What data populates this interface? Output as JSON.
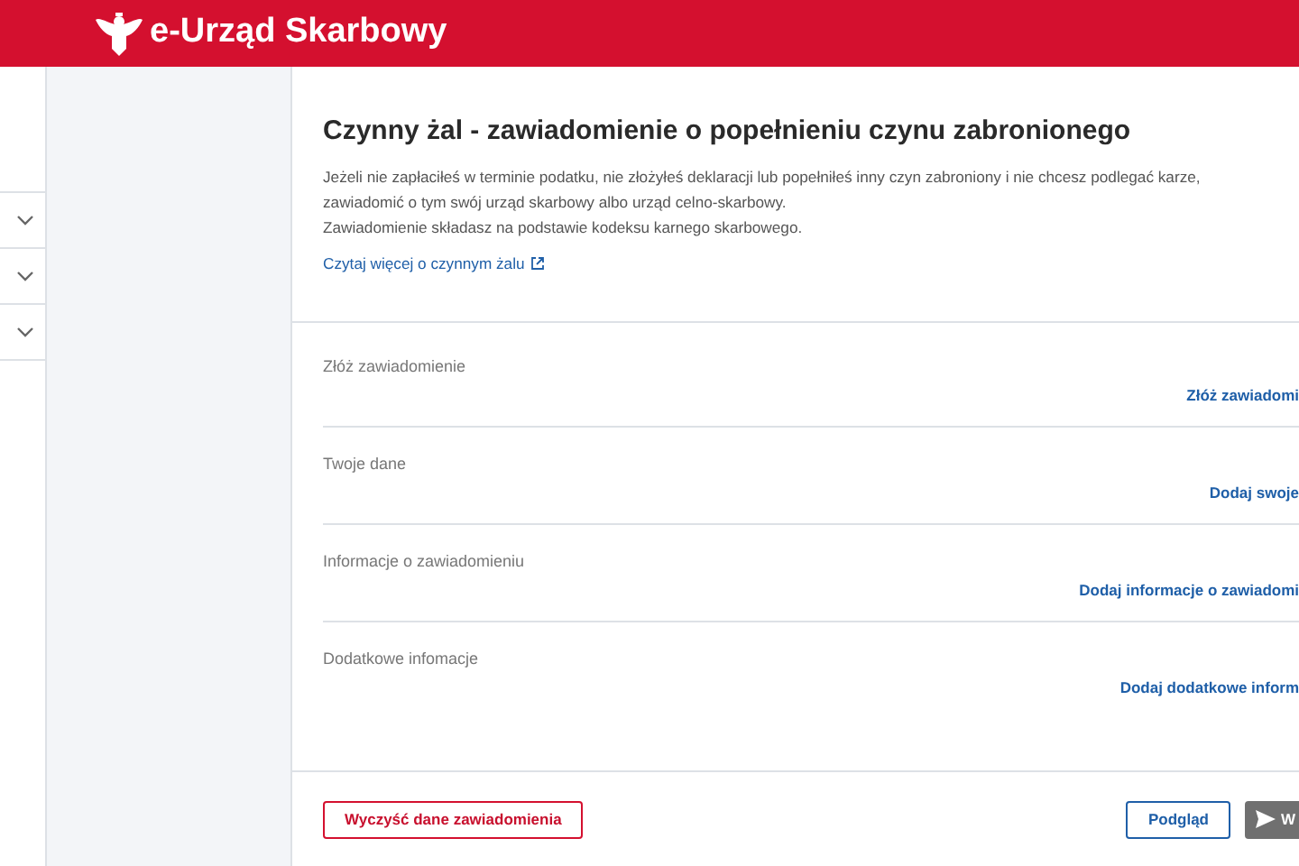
{
  "header": {
    "title": "e-Urząd Skarbowy"
  },
  "sidebar": {
    "items": [
      {
        "expanded": false
      },
      {
        "expanded": false
      },
      {
        "expanded": false
      }
    ]
  },
  "page": {
    "title": "Czynny żal - zawiadomienie o popełnieniu czynu zabronionego",
    "description": [
      "Jeżeli nie zapłaciłeś w terminie podatku, nie złożyłeś deklaracji lub popełniłeś inny czyn zabroniony i nie chcesz podlegać karze,",
      "zawiadomić o tym swój urząd skarbowy albo urząd celno-skarbowy.",
      "Zawiadomienie składasz na podstawie kodeksu karnego skarbowego."
    ],
    "link": "Czytaj więcej o czynnym żalu"
  },
  "sections": [
    {
      "label": "Złóż zawiadomienie",
      "action": "Złóż zawiadomi"
    },
    {
      "label": "Twoje dane",
      "action": "Dodaj swoje"
    },
    {
      "label": "Informacje o zawiadomieniu",
      "action": "Dodaj informacje o zawiadomi"
    },
    {
      "label": "Dodatkowe infomacje",
      "action": "Dodaj dodatkowe inform"
    }
  ],
  "footer": {
    "clear_button": "Wyczyść dane zawiadomienia",
    "preview_button": "Podgląd",
    "send_button": {
      "label": "W",
      "disabled": true
    }
  }
}
